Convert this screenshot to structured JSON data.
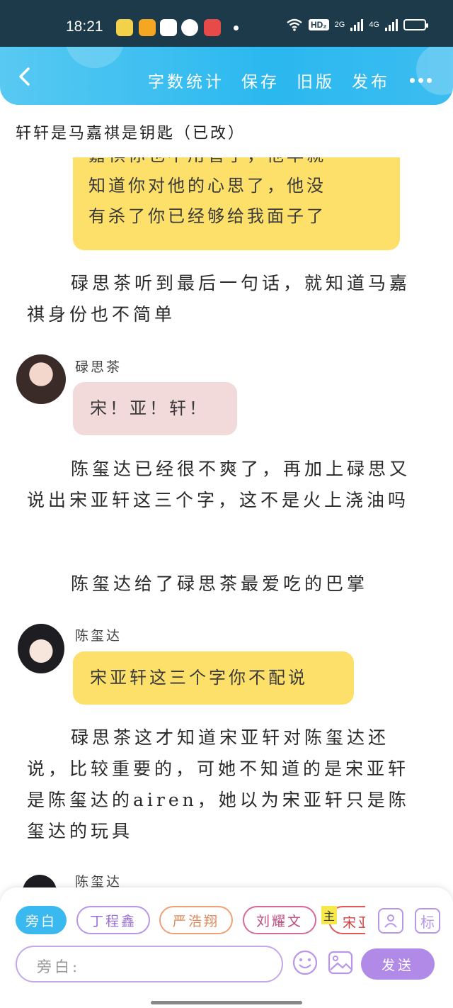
{
  "status_bar": {
    "time": "18:21",
    "hd_badge": "HD₂",
    "net_2g": "2G",
    "net_4g": "4G",
    "battery_level": 0.4
  },
  "header": {
    "actions": [
      "字数统计",
      "保存",
      "旧版",
      "发布"
    ]
  },
  "doc": {
    "title": "轩轩是马嘉祺是钥匙（已改）"
  },
  "content": {
    "bubble_top": [
      "嘉祺你也不用管了，他早就",
      "知道你对他的心思了，他没",
      "有杀了你已经够给我面子了"
    ],
    "para1": "碌思茶听到最后一句话，就知道马嘉祺身份也不简单",
    "speaker1": "碌思茶",
    "bubble1": "宋！亚！轩！",
    "para2": "陈玺达已经很不爽了，再加上碌思又说出宋亚轩这三个字，这不是火上浇油吗",
    "para3": "陈玺达给了碌思茶最爱吃的巴掌",
    "speaker2": "陈玺达",
    "bubble2": "宋亚轩这三个字你不配说",
    "para4": "碌思茶这才知道宋亚轩对陈玺达还说，比较重要的，可她不知道的是宋亚轩是陈玺达的airen，她以为宋亚轩只是陈玺达的玩具",
    "speaker3": "陈玺达"
  },
  "composer": {
    "chips": [
      {
        "label": "旁白",
        "color": "#3ab9f0"
      },
      {
        "label": "丁程鑫",
        "color": "#b896e8"
      },
      {
        "label": "严浩翔",
        "color": "#f0a078"
      },
      {
        "label": "刘耀文",
        "color": "#d86a9a"
      }
    ],
    "partial_chip_badge": "主",
    "partial_chip_label": "宋亚",
    "tag_button_label": "标",
    "input_placeholder": "旁白:",
    "send_label": "发送"
  },
  "colors": {
    "header_accent": "#2ab8ef",
    "yellow_bubble": "#fde06a",
    "pink_bubble": "#f2dada",
    "send_button": "#b18ae8"
  }
}
